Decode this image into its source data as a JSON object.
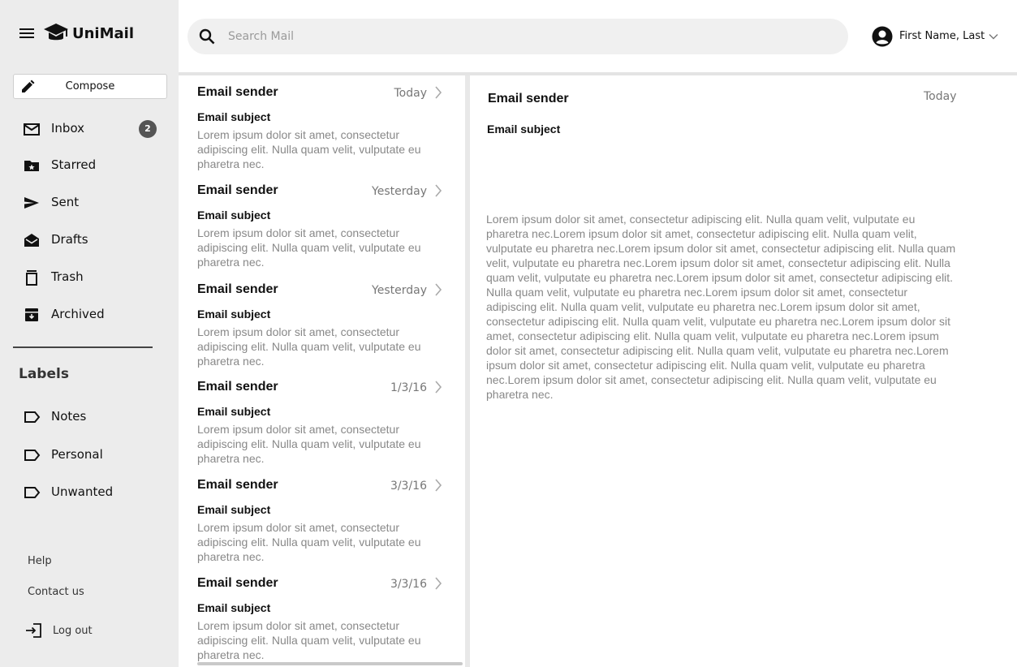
{
  "app": {
    "name": "UniMail"
  },
  "sidebar": {
    "compose_label": "Compose",
    "items": [
      {
        "label": "Inbox",
        "icon": "mail-icon",
        "badge": "2"
      },
      {
        "label": "Starred",
        "icon": "star-folder-icon"
      },
      {
        "label": "Sent",
        "icon": "send-icon"
      },
      {
        "label": "Drafts",
        "icon": "drafts-icon"
      },
      {
        "label": "Trash",
        "icon": "trash-icon"
      },
      {
        "label": "Archived",
        "icon": "archive-icon"
      }
    ],
    "labels_heading": "Labels",
    "labels": [
      {
        "label": "Notes",
        "icon": "label-icon"
      },
      {
        "label": "Personal",
        "icon": "label-icon"
      },
      {
        "label": "Unwanted",
        "icon": "label-icon"
      }
    ],
    "footer": {
      "help": "Help",
      "contact": "Contact us",
      "logout": "Log out"
    }
  },
  "header": {
    "search_placeholder": "Search Mail",
    "user_name": "First Name, Last"
  },
  "emails": [
    {
      "sender": "Email sender",
      "date": "Today",
      "subject": "Email subject",
      "preview": "Lorem ipsum dolor sit amet, consectetur adipiscing elit. Nulla quam velit, vulputate eu pharetra nec."
    },
    {
      "sender": "Email sender",
      "date": "Yesterday",
      "subject": "Email subject",
      "preview": "Lorem ipsum dolor sit amet, consectetur adipiscing elit. Nulla quam velit, vulputate eu pharetra nec."
    },
    {
      "sender": "Email sender",
      "date": "Yesterday",
      "subject": "Email subject",
      "preview": "Lorem ipsum dolor sit amet, consectetur adipiscing elit. Nulla quam velit, vulputate eu pharetra nec."
    },
    {
      "sender": "Email sender",
      "date": "1/3/16",
      "subject": "Email subject",
      "preview": "Lorem ipsum dolor sit amet, consectetur adipiscing elit. Nulla quam velit, vulputate eu pharetra nec."
    },
    {
      "sender": "Email sender",
      "date": "3/3/16",
      "subject": "Email subject",
      "preview": "Lorem ipsum dolor sit amet, consectetur adipiscing elit. Nulla quam velit, vulputate eu pharetra nec."
    },
    {
      "sender": "Email sender",
      "date": "3/3/16",
      "subject": "Email subject",
      "preview": "Lorem ipsum dolor sit amet, consectetur adipiscing elit. Nulla quam velit, vulputate eu pharetra nec."
    }
  ],
  "reader": {
    "sender": "Email sender",
    "date": "Today",
    "subject": "Email subject",
    "body": "Lorem ipsum dolor sit amet, consectetur adipiscing elit. Nulla quam velit, vulputate eu pharetra nec.Lorem ipsum dolor sit amet, consectetur adipiscing elit. Nulla quam velit, vulputate eu pharetra nec.Lorem ipsum dolor sit amet, consectetur adipiscing elit. Nulla quam velit, vulputate eu pharetra nec.Lorem ipsum dolor sit amet, consectetur adipiscing elit. Nulla quam velit, vulputate eu pharetra nec.Lorem ipsum dolor sit amet, consectetur adipiscing elit. Nulla quam velit, vulputate eu pharetra nec.Lorem ipsum dolor sit amet, consectetur adipiscing elit. Nulla quam velit, vulputate eu pharetra nec.Lorem ipsum dolor sit amet, consectetur adipiscing elit. Nulla quam velit, vulputate eu pharetra nec.Lorem ipsum dolor sit amet, consectetur adipiscing elit. Nulla quam velit, vulputate eu pharetra nec.Lorem ipsum dolor sit amet, consectetur adipiscing elit. Nulla quam velit, vulputate eu pharetra nec.Lorem ipsum dolor sit amet, consectetur adipiscing elit. Nulla quam velit, vulputate eu pharetra nec.Lorem ipsum dolor sit amet, consectetur adipiscing elit. Nulla quam velit, vulputate eu pharetra nec."
  },
  "colors": {
    "sidebar_bg": "#ececec",
    "search_bg": "#f0f0f0",
    "badge_bg": "#555555",
    "muted_text": "#888888"
  }
}
